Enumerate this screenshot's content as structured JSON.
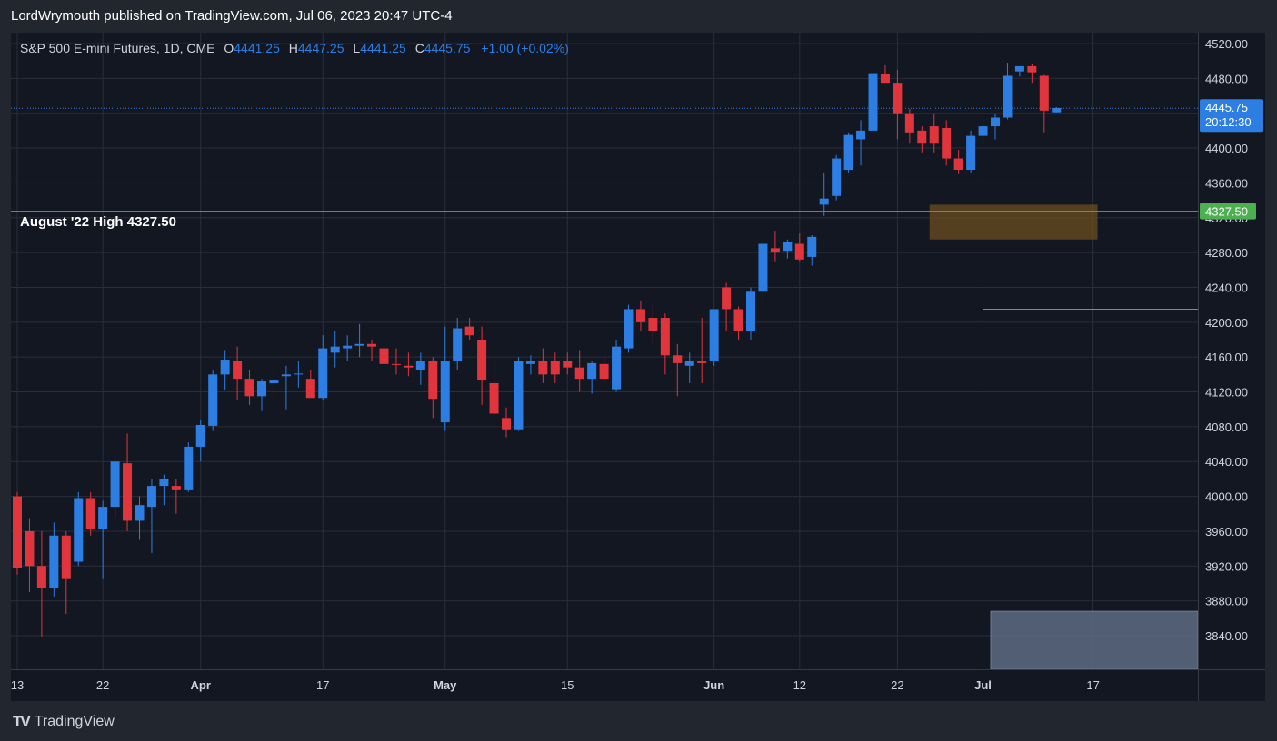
{
  "header": {
    "text": "LordWrymouth published on TradingView.com, Jul 06, 2023 20:47 UTC-4"
  },
  "legend": {
    "symbol": "S&P 500 E-mini Futures, 1D, CME",
    "o_label": "O",
    "o_value": "4441.25",
    "h_label": "H",
    "h_value": "4447.25",
    "l_label": "L",
    "l_value": "4441.25",
    "c_label": "C",
    "c_value": "4445.75",
    "change": "+1.00 (+0.02%)"
  },
  "annotation": {
    "text": "August '22 High 4327.50"
  },
  "price_tags": {
    "current_price": "4445.75",
    "countdown": "20:12:30",
    "level": "4327.50"
  },
  "footer": {
    "logo": "TV",
    "brand": "TradingView"
  },
  "colors": {
    "up": "#2d7ee3",
    "down": "#e0353d",
    "level_line": "#4caf50",
    "zone": "#6b4f1e",
    "box": "#5d6b82",
    "cyan_line": "#3ba3c8"
  },
  "chart_data": {
    "type": "candlestick",
    "y_axis": {
      "min": 3820,
      "max": 4530,
      "ticks": [
        "4520.00",
        "4480.00",
        "4440.00",
        "4400.00",
        "4360.00",
        "4320.00",
        "4280.00",
        "4240.00",
        "4200.00",
        "4160.00",
        "4120.00",
        "4080.00",
        "4040.00",
        "4000.00",
        "3960.00",
        "3920.00",
        "3880.00",
        "3840.00"
      ],
      "tick_values": [
        4520,
        4480,
        4440,
        4400,
        4360,
        4320,
        4280,
        4240,
        4200,
        4160,
        4120,
        4080,
        4040,
        4000,
        3960,
        3920,
        3880,
        3840
      ]
    },
    "x_axis": {
      "labels": [
        {
          "text": "13",
          "index": 0,
          "bold": false
        },
        {
          "text": "22",
          "index": 7,
          "bold": false
        },
        {
          "text": "Apr",
          "index": 15,
          "bold": true
        },
        {
          "text": "17",
          "index": 25,
          "bold": false
        },
        {
          "text": "May",
          "index": 35,
          "bold": true
        },
        {
          "text": "15",
          "index": 45,
          "bold": false
        },
        {
          "text": "Jun",
          "index": 57,
          "bold": true
        },
        {
          "text": "12",
          "index": 64,
          "bold": false
        },
        {
          "text": "22",
          "index": 72,
          "bold": false
        },
        {
          "text": "Jul",
          "index": 79,
          "bold": true
        },
        {
          "text": "17",
          "index": 88,
          "bold": false
        }
      ]
    },
    "level_line": {
      "value": 4327.5
    },
    "current_price": 4445.75,
    "zone": {
      "from_index": 75,
      "to_index": 88,
      "low": 4295,
      "high": 4335
    },
    "cyan_segment": {
      "from_index": 79,
      "value": 4215
    },
    "box": {
      "from_index": 80,
      "low": 3820,
      "high": 3868
    },
    "candles": [
      {
        "o": 4000,
        "h": 4005,
        "l": 3910,
        "c": 3918
      },
      {
        "o": 3960,
        "h": 3975,
        "l": 3890,
        "c": 3920
      },
      {
        "o": 3920,
        "h": 3960,
        "l": 3838,
        "c": 3895
      },
      {
        "o": 3895,
        "h": 3970,
        "l": 3885,
        "c": 3955
      },
      {
        "o": 3955,
        "h": 3960,
        "l": 3865,
        "c": 3905
      },
      {
        "o": 3925,
        "h": 4005,
        "l": 3920,
        "c": 3998
      },
      {
        "o": 3998,
        "h": 4005,
        "l": 3955,
        "c": 3962
      },
      {
        "o": 3963,
        "h": 3995,
        "l": 3905,
        "c": 3988
      },
      {
        "o": 3988,
        "h": 4040,
        "l": 3975,
        "c": 4040
      },
      {
        "o": 4038,
        "h": 4072,
        "l": 3960,
        "c": 3972
      },
      {
        "o": 3972,
        "h": 4000,
        "l": 3950,
        "c": 3990
      },
      {
        "o": 3988,
        "h": 4020,
        "l": 3935,
        "c": 4012
      },
      {
        "o": 4012,
        "h": 4025,
        "l": 3990,
        "c": 4020
      },
      {
        "o": 4012,
        "h": 4020,
        "l": 3980,
        "c": 4007
      },
      {
        "o": 4007,
        "h": 4062,
        "l": 4005,
        "c": 4057
      },
      {
        "o": 4057,
        "h": 4088,
        "l": 4040,
        "c": 4082
      },
      {
        "o": 4081,
        "h": 4145,
        "l": 4075,
        "c": 4140
      },
      {
        "o": 4140,
        "h": 4168,
        "l": 4122,
        "c": 4157
      },
      {
        "o": 4155,
        "h": 4172,
        "l": 4110,
        "c": 4135
      },
      {
        "o": 4135,
        "h": 4145,
        "l": 4105,
        "c": 4115
      },
      {
        "o": 4115,
        "h": 4135,
        "l": 4098,
        "c": 4132
      },
      {
        "o": 4130,
        "h": 4142,
        "l": 4115,
        "c": 4133
      },
      {
        "o": 4138,
        "h": 4150,
        "l": 4100,
        "c": 4140
      },
      {
        "o": 4140,
        "h": 4155,
        "l": 4125,
        "c": 4141
      },
      {
        "o": 4135,
        "h": 4145,
        "l": 4115,
        "c": 4113
      },
      {
        "o": 4113,
        "h": 4185,
        "l": 4110,
        "c": 4170
      },
      {
        "o": 4165,
        "h": 4190,
        "l": 4148,
        "c": 4172
      },
      {
        "o": 4170,
        "h": 4185,
        "l": 4155,
        "c": 4173
      },
      {
        "o": 4173,
        "h": 4198,
        "l": 4160,
        "c": 4175
      },
      {
        "o": 4175,
        "h": 4180,
        "l": 4155,
        "c": 4172
      },
      {
        "o": 4170,
        "h": 4175,
        "l": 4148,
        "c": 4152
      },
      {
        "o": 4152,
        "h": 4170,
        "l": 4140,
        "c": 4151
      },
      {
        "o": 4150,
        "h": 4165,
        "l": 4138,
        "c": 4148
      },
      {
        "o": 4145,
        "h": 4165,
        "l": 4128,
        "c": 4155
      },
      {
        "o": 4155,
        "h": 4160,
        "l": 4090,
        "c": 4112
      },
      {
        "o": 4085,
        "h": 4195,
        "l": 4075,
        "c": 4155
      },
      {
        "o": 4155,
        "h": 4205,
        "l": 4145,
        "c": 4193
      },
      {
        "o": 4195,
        "h": 4205,
        "l": 4180,
        "c": 4185
      },
      {
        "o": 4180,
        "h": 4195,
        "l": 4105,
        "c": 4133
      },
      {
        "o": 4130,
        "h": 4160,
        "l": 4090,
        "c": 4095
      },
      {
        "o": 4090,
        "h": 4102,
        "l": 4068,
        "c": 4077
      },
      {
        "o": 4077,
        "h": 4160,
        "l": 4075,
        "c": 4155
      },
      {
        "o": 4152,
        "h": 4162,
        "l": 4140,
        "c": 4156
      },
      {
        "o": 4155,
        "h": 4170,
        "l": 4130,
        "c": 4140
      },
      {
        "o": 4155,
        "h": 4165,
        "l": 4130,
        "c": 4140
      },
      {
        "o": 4155,
        "h": 4165,
        "l": 4140,
        "c": 4148
      },
      {
        "o": 4148,
        "h": 4168,
        "l": 4120,
        "c": 4135
      },
      {
        "o": 4135,
        "h": 4155,
        "l": 4118,
        "c": 4153
      },
      {
        "o": 4152,
        "h": 4162,
        "l": 4130,
        "c": 4135
      },
      {
        "o": 4123,
        "h": 4180,
        "l": 4120,
        "c": 4172
      },
      {
        "o": 4170,
        "h": 4220,
        "l": 4165,
        "c": 4215
      },
      {
        "o": 4215,
        "h": 4225,
        "l": 4190,
        "c": 4200
      },
      {
        "o": 4205,
        "h": 4220,
        "l": 4175,
        "c": 4190
      },
      {
        "o": 4205,
        "h": 4210,
        "l": 4140,
        "c": 4162
      },
      {
        "o": 4162,
        "h": 4175,
        "l": 4115,
        "c": 4153
      },
      {
        "o": 4150,
        "h": 4165,
        "l": 4130,
        "c": 4155
      },
      {
        "o": 4155,
        "h": 4205,
        "l": 4130,
        "c": 4153
      },
      {
        "o": 4155,
        "h": 4215,
        "l": 4150,
        "c": 4215
      },
      {
        "o": 4240,
        "h": 4245,
        "l": 4190,
        "c": 4215
      },
      {
        "o": 4215,
        "h": 4218,
        "l": 4180,
        "c": 4190
      },
      {
        "o": 4190,
        "h": 4240,
        "l": 4180,
        "c": 4235
      },
      {
        "o": 4235,
        "h": 4295,
        "l": 4225,
        "c": 4290
      },
      {
        "o": 4285,
        "h": 4305,
        "l": 4270,
        "c": 4280
      },
      {
        "o": 4282,
        "h": 4295,
        "l": 4273,
        "c": 4292
      },
      {
        "o": 4290,
        "h": 4302,
        "l": 4270,
        "c": 4272
      },
      {
        "o": 4275,
        "h": 4300,
        "l": 4265,
        "c": 4298
      },
      {
        "o": 4335,
        "h": 4372,
        "l": 4322,
        "c": 4342
      },
      {
        "o": 4345,
        "h": 4392,
        "l": 4340,
        "c": 4388
      },
      {
        "o": 4375,
        "h": 4418,
        "l": 4372,
        "c": 4415
      },
      {
        "o": 4410,
        "h": 4432,
        "l": 4380,
        "c": 4420
      },
      {
        "o": 4420,
        "h": 4488,
        "l": 4408,
        "c": 4486
      },
      {
        "o": 4485,
        "h": 4495,
        "l": 4475,
        "c": 4475
      },
      {
        "o": 4475,
        "h": 4490,
        "l": 4410,
        "c": 4440
      },
      {
        "o": 4440,
        "h": 4445,
        "l": 4405,
        "c": 4418
      },
      {
        "o": 4420,
        "h": 4425,
        "l": 4395,
        "c": 4405
      },
      {
        "o": 4425,
        "h": 4440,
        "l": 4395,
        "c": 4405
      },
      {
        "o": 4423,
        "h": 4432,
        "l": 4380,
        "c": 4388
      },
      {
        "o": 4388,
        "h": 4398,
        "l": 4370,
        "c": 4375
      },
      {
        "o": 4375,
        "h": 4420,
        "l": 4372,
        "c": 4414
      },
      {
        "o": 4414,
        "h": 4432,
        "l": 4405,
        "c": 4425
      },
      {
        "o": 4425,
        "h": 4440,
        "l": 4410,
        "c": 4435
      },
      {
        "o": 4435,
        "h": 4498,
        "l": 4433,
        "c": 4483
      },
      {
        "o": 4488,
        "h": 4492,
        "l": 4482,
        "c": 4494
      },
      {
        "o": 4494,
        "h": 4496,
        "l": 4475,
        "c": 4487
      },
      {
        "o": 4483,
        "h": 4484,
        "l": 4418,
        "c": 4443
      },
      {
        "o": 4441,
        "h": 4447,
        "l": 4441,
        "c": 4446
      }
    ]
  }
}
